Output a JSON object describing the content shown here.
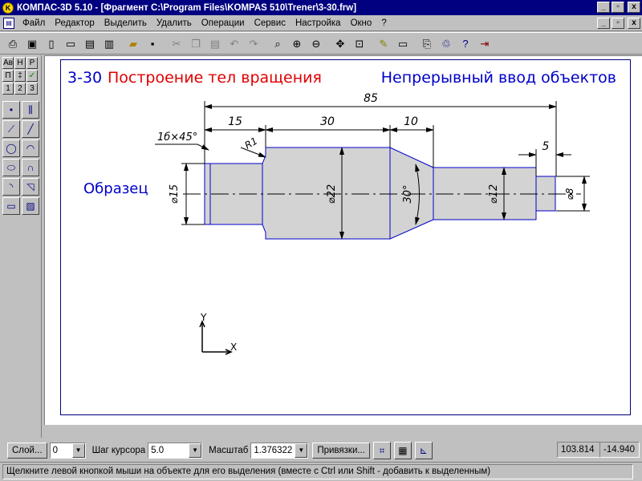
{
  "window": {
    "title": "КОМПАС-3D 5.10 - [Фрагмент C:\\Program Files\\KOMPAS 510\\Trener\\3-30.frw]",
    "app_icon": "kompas-logo-icon",
    "controls": [
      "_",
      "▫",
      "x"
    ]
  },
  "menu": {
    "items": [
      "Файл",
      "Редактор",
      "Выделить",
      "Удалить",
      "Операции",
      "Сервис",
      "Настройка",
      "Окно",
      "?"
    ]
  },
  "toolbar": {
    "icons": [
      "print-preview-icon",
      "print-icon",
      "new-document-icon",
      "new-sheet-icon",
      "new-text-icon",
      "new-spec-icon",
      "open-folder-icon",
      "save-icon",
      "cut-icon",
      "copy-icon",
      "paste-icon",
      "undo-icon",
      "redo-icon",
      "zoom-window-icon",
      "zoom-in-icon",
      "zoom-out-icon",
      "pan-icon",
      "zoom-all-icon",
      "refresh-icon",
      "view-manager-icon",
      "properties-icon",
      "library-icon",
      "help-icon",
      "exit-icon"
    ]
  },
  "left_panel": {
    "top_cells": [
      "Ав",
      "H",
      "P",
      "П",
      "‡",
      "✓",
      "1",
      "2",
      "3"
    ],
    "tools": [
      "point-tool-icon",
      "aux-line-tool-icon",
      "segment-tool-icon",
      "line-tool-icon",
      "circle-tool-icon",
      "arc-tool-icon",
      "ellipse-tool-icon",
      "spline-tool-icon",
      "fillet-tool-icon",
      "chamfer-tool-icon",
      "rectangle-tool-icon",
      "hatch-tool-icon"
    ]
  },
  "drawing": {
    "task_number": "3-30",
    "task_title": "Построение тел вращения",
    "mode_title": "Непрерывный ввод объектов",
    "sample_label": "Образец",
    "dimensions": {
      "overall": "85",
      "step1": "15",
      "step2": "30",
      "step3": "10",
      "step4": "5",
      "chamfer": "1б×45°",
      "radius": "R1",
      "d1": "⌀15",
      "d2": "⌀22",
      "angle": "30°",
      "d3": "⌀12",
      "d4": "⌀8"
    },
    "axis_x": "X",
    "axis_y": "Y",
    "colors": {
      "part_fill": "#d3d3d3",
      "outline": "#0000c8",
      "title_red": "#e00000",
      "title_blue": "#0000c8"
    }
  },
  "status_controls": {
    "layer_button": "Слой...",
    "layer_value": "0",
    "cursor_step_label": "Шаг курсора",
    "cursor_step_value": "5.0",
    "scale_label": "Масштаб",
    "scale_value": "1.376322",
    "snaps_button": "Привязки...",
    "coord_x": "103.814",
    "coord_y": "-14.940"
  },
  "status_bar": {
    "message": "Щелкните левой кнопкой мыши на объекте для его выделения (вместе с Ctrl или Shift - добавить к выделенным)"
  }
}
